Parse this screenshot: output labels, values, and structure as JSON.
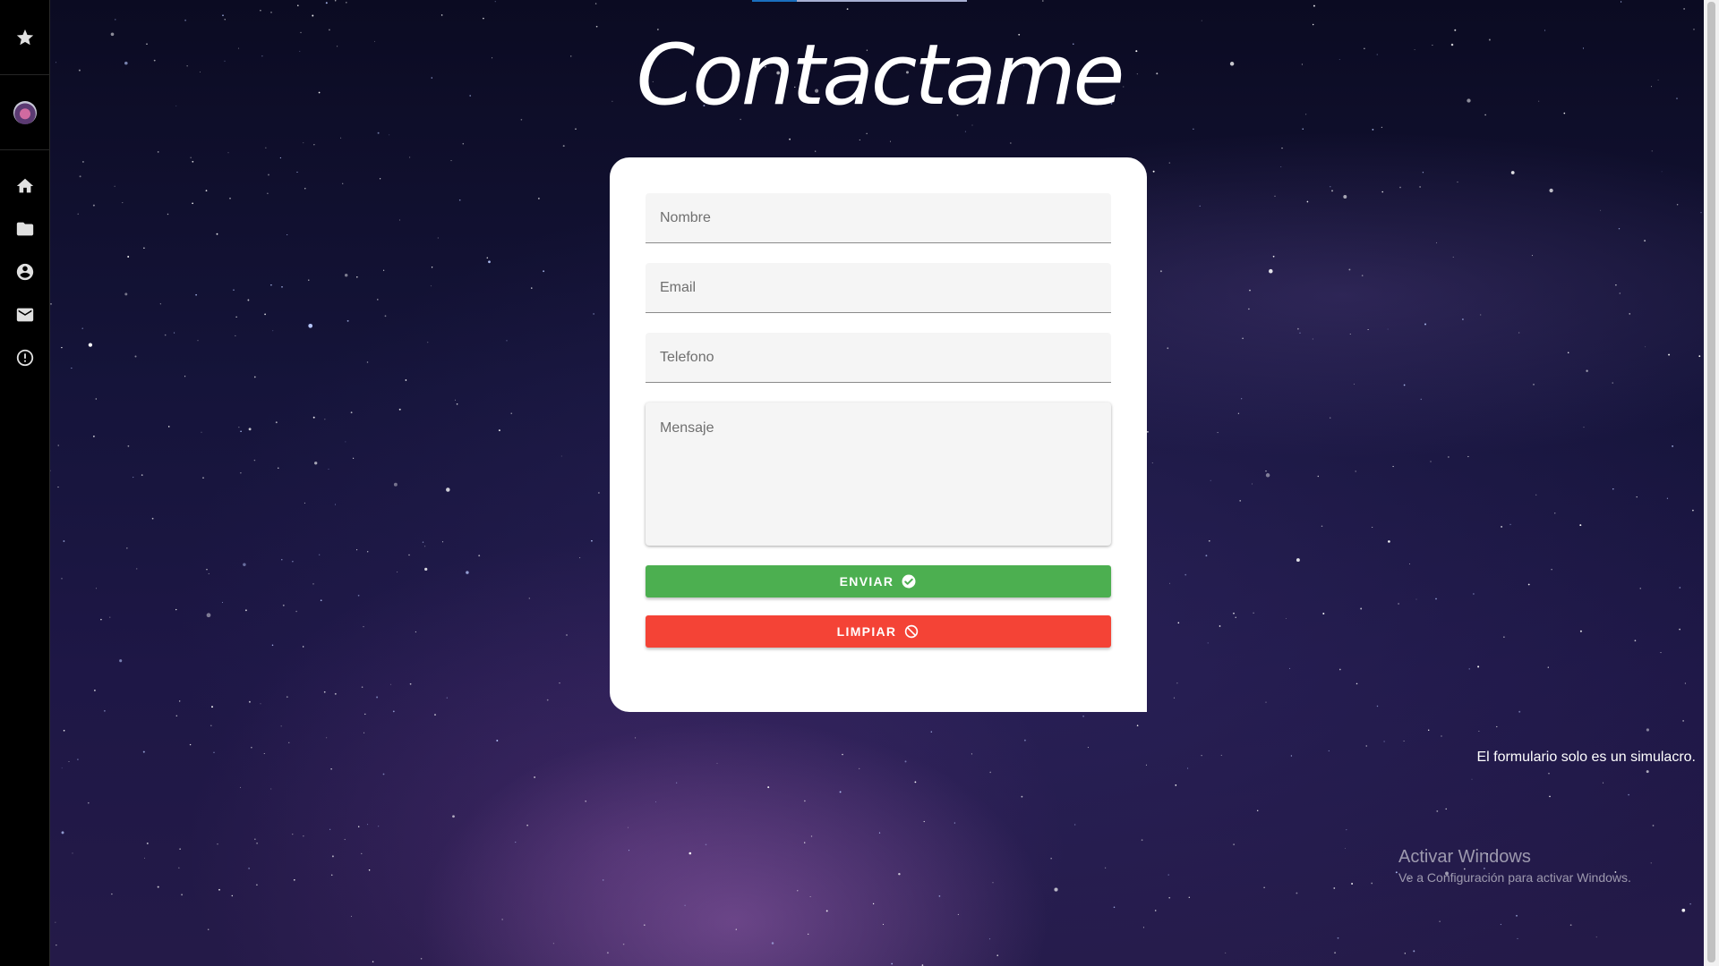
{
  "page": {
    "title": "Contactame"
  },
  "sidebar": {
    "top_icon": "star-icon",
    "avatar": "user-avatar",
    "items": [
      {
        "name": "home",
        "icon": "home-icon"
      },
      {
        "name": "projects",
        "icon": "folder-icon"
      },
      {
        "name": "profile",
        "icon": "account-circle-icon"
      },
      {
        "name": "contact",
        "icon": "mail-icon"
      },
      {
        "name": "info",
        "icon": "alert-circle-icon"
      }
    ]
  },
  "form": {
    "name_placeholder": "Nombre",
    "email_placeholder": "Email",
    "phone_placeholder": "Telefono",
    "message_placeholder": "Mensaje",
    "send_label": "ENVIAR",
    "send_icon": "check-circle-icon",
    "clear_label": "LIMPIAR",
    "clear_icon": "block-icon"
  },
  "note": "El formulario solo es un simulacro.",
  "watermark": {
    "title": "Activar Windows",
    "subtitle": "Ve a Configuración para activar Windows."
  },
  "colors": {
    "send": "#4caf50",
    "clear": "#f44336",
    "sidebar": "#000000",
    "card": "#ffffff"
  }
}
